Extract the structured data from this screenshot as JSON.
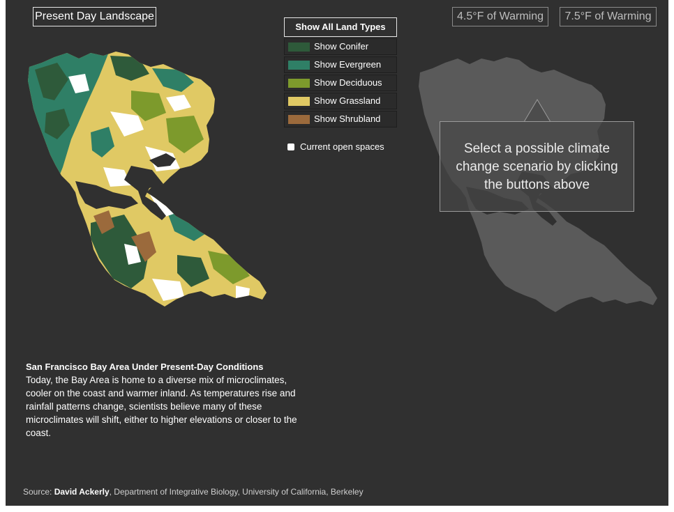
{
  "header": {
    "present_button": "Present Day Landscape",
    "warming_buttons": [
      "4.5°F of Warming",
      "7.5°F of Warming"
    ]
  },
  "legend": {
    "show_all": "Show All Land Types",
    "items": [
      {
        "label": "Show Conifer",
        "color": "#2e5a3a"
      },
      {
        "label": "Show Evergreen",
        "color": "#2f7f66"
      },
      {
        "label": "Show Deciduous",
        "color": "#7d9a2c"
      },
      {
        "label": "Show Grassland",
        "color": "#e0c964"
      },
      {
        "label": "Show Shrubland",
        "color": "#9b6a3c"
      }
    ],
    "open_spaces": "Current open spaces"
  },
  "prompt": {
    "lines": [
      "Select a possible climate",
      "change scenario by clicking",
      "the buttons above"
    ]
  },
  "description": {
    "title": "San Francisco Bay Area Under Present-Day Conditions",
    "body": "Today, the Bay Area is home to a diverse mix of microclimates, cooler on the coast and warmer inland. As temperatures rise and rainfall patterns change, scientists believe many of these microclimates will shift, either to higher elevations or closer to the coast."
  },
  "source": {
    "prefix": "Source: ",
    "author": "David Ackerly",
    "affiliation": ", Department of Integrative Biology, University of California, Berkeley"
  },
  "colors": {
    "background": "#303030",
    "map_gray": "#5a5a5a",
    "white_space": "#ffffff"
  }
}
